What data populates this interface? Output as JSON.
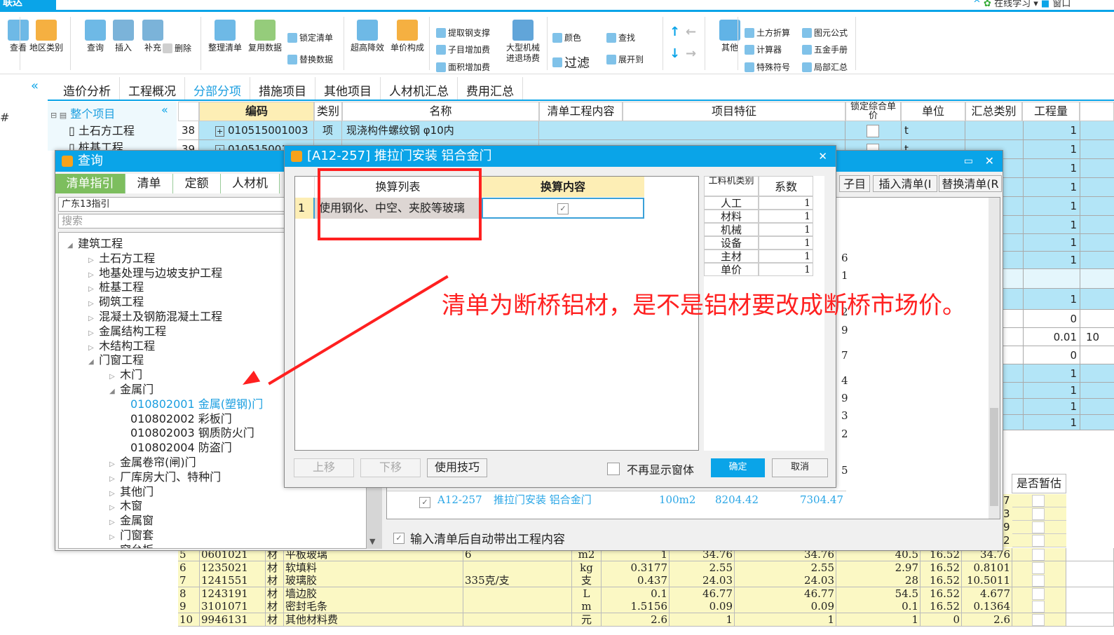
{
  "app": {
    "tab": "联达",
    "online_learning": "在线学习",
    "window": "窗口"
  },
  "ribbon": {
    "items": [
      "查看",
      "地区类别",
      "查询",
      "插入",
      "补充",
      "删除",
      "整理清单",
      "复用数据",
      "锁定清单",
      "替换数据",
      "超高降效",
      "单价构成",
      "提取钢支撑",
      "子目增加费",
      "面积增加费",
      "大型机械\n进退场费",
      "颜色",
      "查找",
      "过滤",
      "展开到",
      "其他",
      "土方折算",
      "图元公式",
      "计算器",
      "五金手册",
      "特殊符号",
      "局部汇总"
    ]
  },
  "tabs": [
    "造价分析",
    "工程概况",
    "分部分项",
    "措施项目",
    "其他项目",
    "人材机汇总",
    "费用汇总"
  ],
  "active_tab": "分部分项",
  "left_tree": {
    "root": "整个项目",
    "items": [
      "土石方工程",
      "桩基工程"
    ]
  },
  "grid": {
    "headers": [
      "编码",
      "类别",
      "名称",
      "清单工程内容",
      "项目特征",
      "锁定综合单价",
      "单位",
      "汇总类别",
      "工程量"
    ],
    "rows": [
      {
        "no": "38",
        "code": "010515001003",
        "type": "项",
        "name": "现浇构件螺纹钢 φ10内",
        "unit": "t"
      },
      {
        "no": "39",
        "code": "010515001",
        "type": "",
        "name": "",
        "unit": "t"
      }
    ],
    "quantities": [
      "1",
      "1",
      "1",
      "1",
      "1",
      "1",
      "1",
      "1",
      "",
      "1",
      "0",
      "0.01",
      "0",
      "1",
      "1",
      "1",
      "1"
    ],
    "extra_col_value": "10"
  },
  "query_window": {
    "title": "查询",
    "tabs": [
      "清单指引",
      "清单",
      "定额",
      "人材机"
    ],
    "buttons": [
      "子目",
      "插入清单(I",
      "替换清单(R"
    ],
    "guide_value": "广东13指引",
    "search_placeholder": "搜索",
    "tree": [
      {
        "l": 0,
        "t": "建筑工程",
        "e": "open"
      },
      {
        "l": 1,
        "t": "土石方工程"
      },
      {
        "l": 1,
        "t": "地基处理与边坡支护工程"
      },
      {
        "l": 1,
        "t": "桩基工程"
      },
      {
        "l": 1,
        "t": "砌筑工程"
      },
      {
        "l": 1,
        "t": "混凝土及钢筋混凝土工程"
      },
      {
        "l": 1,
        "t": "金属结构工程"
      },
      {
        "l": 1,
        "t": "木结构工程"
      },
      {
        "l": 1,
        "t": "门窗工程",
        "e": "open"
      },
      {
        "l": 2,
        "t": "木门"
      },
      {
        "l": 2,
        "t": "金属门",
        "e": "open"
      },
      {
        "l": 3,
        "t": "010802001   金属(塑钢)门",
        "sel": true
      },
      {
        "l": 3,
        "t": "010802002   彩板门"
      },
      {
        "l": 3,
        "t": "010802003   钢质防火门"
      },
      {
        "l": 3,
        "t": "010802004   防盗门"
      },
      {
        "l": 2,
        "t": "金属卷帘(闸)门"
      },
      {
        "l": 2,
        "t": "厂库房大门、特种门"
      },
      {
        "l": 2,
        "t": "其他门"
      },
      {
        "l": 2,
        "t": "木窗"
      },
      {
        "l": 2,
        "t": "金属窗"
      },
      {
        "l": 2,
        "t": "门窗套"
      },
      {
        "l": 2,
        "t": "窗台板"
      }
    ],
    "list_digits": [
      "6",
      "1",
      "2",
      "9",
      "7",
      "4",
      "9",
      "3",
      "2",
      "5"
    ],
    "quota_row": {
      "code": "A12-257",
      "name": "推拉门安装 铝合金门",
      "unit": "100m2",
      "price1": "8204.42",
      "price2": "7304.47"
    },
    "auto_content_label": "输入清单后自动带出工程内容"
  },
  "dialog": {
    "title": "[A12-257] 推拉门安装 铝合金门",
    "col_list": "换算列表",
    "col_content": "换算内容",
    "rows": [
      {
        "no": "1",
        "text": "使用钢化、中空、夹胶等玻璃",
        "checked": true
      }
    ],
    "coef_headers": [
      "工料机类别",
      "系数"
    ],
    "coefs": [
      [
        "人工",
        "1"
      ],
      [
        "材料",
        "1"
      ],
      [
        "机械",
        "1"
      ],
      [
        "设备",
        "1"
      ],
      [
        "主材",
        "1"
      ],
      [
        "单价",
        "1"
      ]
    ],
    "buttons": {
      "up": "上移",
      "down": "下移",
      "tips": "使用技巧",
      "no_show": "不再显示窗体",
      "ok": "确定",
      "cancel": "取消"
    }
  },
  "annotation": {
    "text": "清单为断桥铝材，是不是铝材要改成断桥市场价。",
    "color": "#ff2020"
  },
  "estimate_header": "是否暂估",
  "estimate_digits": [
    "7",
    "3",
    "9",
    "2"
  ],
  "bottom_table": [
    [
      "5",
      "0601021",
      "材",
      "平板玻璃",
      "6",
      "m2",
      "1",
      "34.76",
      "34.76",
      "40.5",
      "16.52",
      "34.76"
    ],
    [
      "6",
      "1235021",
      "材",
      "软填料",
      "",
      "kg",
      "0.3177",
      "2.55",
      "2.55",
      "2.97",
      "16.52",
      "0.8101"
    ],
    [
      "7",
      "1241551",
      "材",
      "玻璃胶",
      "335克/支",
      "支",
      "0.437",
      "24.03",
      "24.03",
      "28",
      "16.52",
      "10.5011"
    ],
    [
      "8",
      "1243191",
      "材",
      "墙边胶",
      "",
      "L",
      "0.1",
      "46.77",
      "46.77",
      "54.5",
      "16.52",
      "4.677"
    ],
    [
      "9",
      "3101071",
      "材",
      "密封毛条",
      "",
      "m",
      "1.5156",
      "0.09",
      "0.09",
      "0.1",
      "16.52",
      "0.1364"
    ],
    [
      "10",
      "9946131",
      "材",
      "其他材料费",
      "",
      "元",
      "2.6",
      "1",
      "1",
      "1",
      "0",
      "2.6"
    ]
  ],
  "colors": {
    "accent": "#0aa4e8",
    "row_blue": "#b3e5f7",
    "yellow": "#fbf8c4",
    "green_tab": "#7dbe5e"
  }
}
